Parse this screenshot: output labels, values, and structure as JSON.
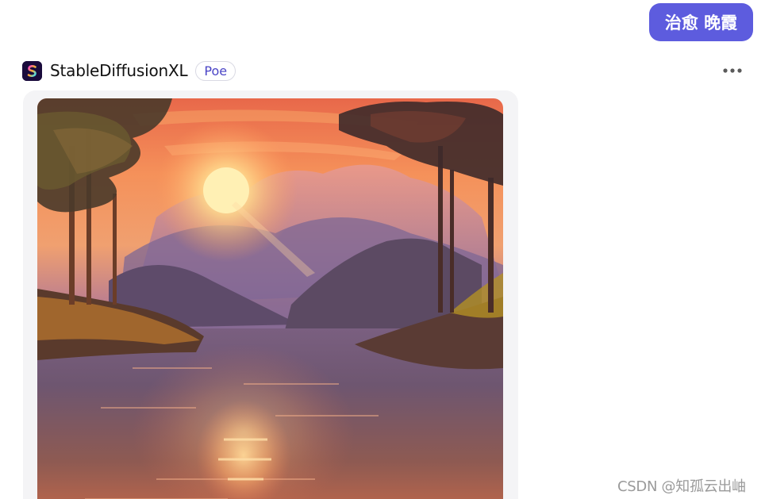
{
  "user_message": {
    "text": "治愈 晚霞"
  },
  "bot": {
    "icon": "stablediffusion-logo-icon",
    "name": "StableDiffusionXL",
    "badge": "Poe"
  },
  "more_menu": {
    "icon": "more-horizontal-icon"
  },
  "generated_image": {
    "alt": "sunset river landscape painting"
  },
  "watermark": {
    "text": "CSDN @知孤云出岫"
  },
  "colors": {
    "accent": "#5d5cde",
    "badge_text": "#4a44c6",
    "card_bg": "#f4f4f6"
  }
}
